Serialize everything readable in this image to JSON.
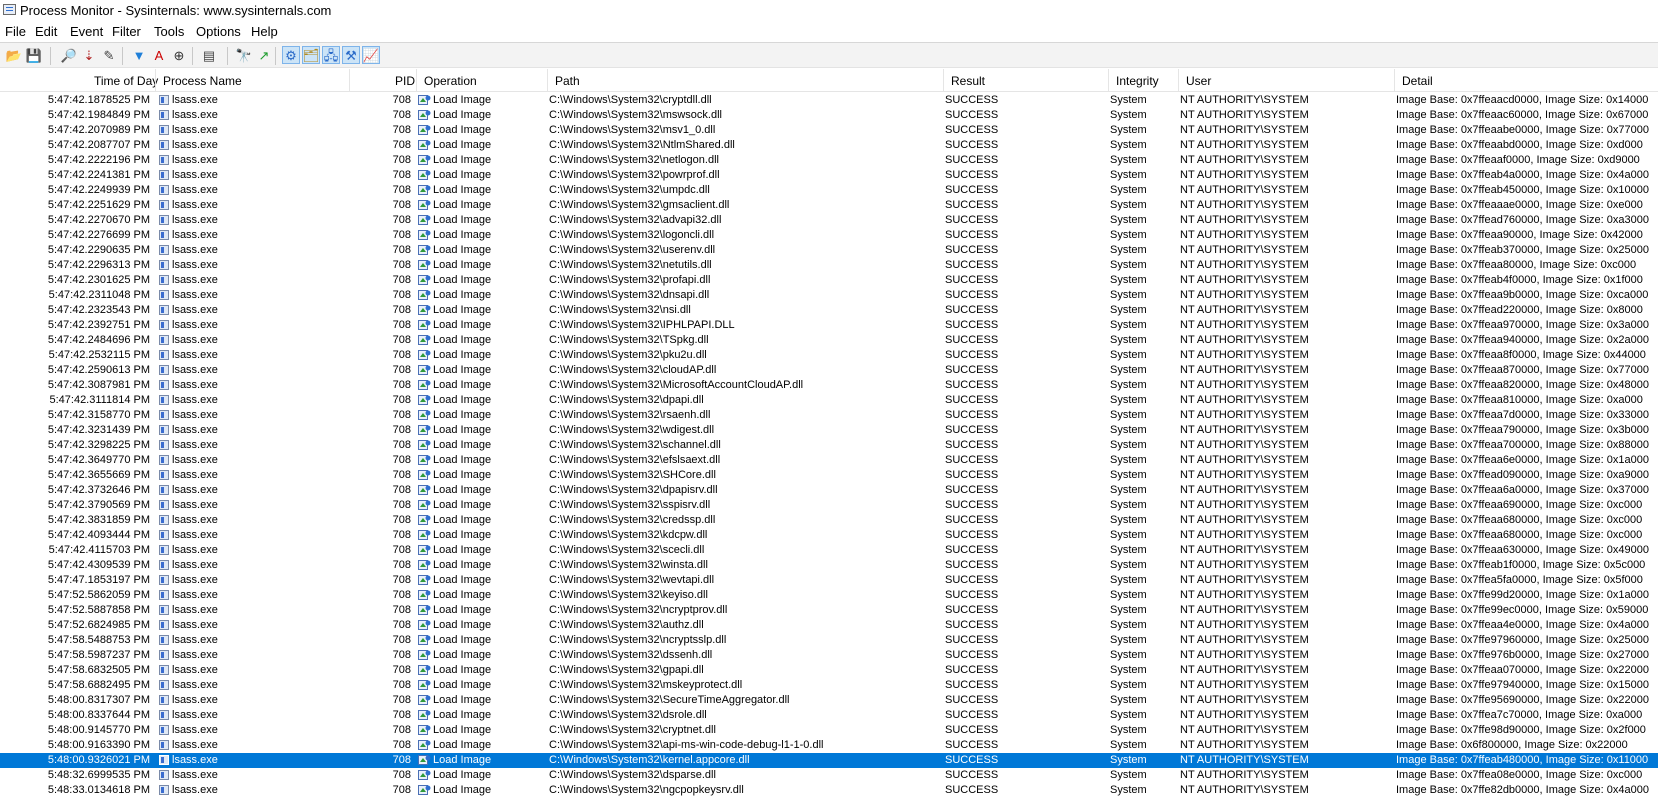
{
  "window": {
    "title": "Process Monitor - Sysinternals: www.sysinternals.com"
  },
  "menu": [
    "File",
    "Edit",
    "Event",
    "Filter",
    "Tools",
    "Options",
    "Help"
  ],
  "toolbar": {
    "buttons": [
      {
        "name": "open-icon",
        "glyph": "📂",
        "color": "#c9a23a",
        "on": false
      },
      {
        "name": "save-icon",
        "glyph": "💾",
        "color": "#333333",
        "on": false
      },
      {
        "name": "capture-icon",
        "glyph": "🔎",
        "color": "#555555",
        "on": false
      },
      {
        "name": "autoscroll-icon",
        "glyph": "⇣",
        "color": "#b02020",
        "on": false
      },
      {
        "name": "clear-icon",
        "glyph": "✎",
        "color": "#444444",
        "on": false
      },
      {
        "name": "filter-icon",
        "glyph": "▼",
        "color": "#1f7fd8",
        "on": false
      },
      {
        "name": "highlight-icon",
        "glyph": "A",
        "color": "#cc0000",
        "on": false
      },
      {
        "name": "include-process-icon",
        "glyph": "⊕",
        "color": "#333333",
        "on": false
      },
      {
        "name": "process-tree-icon",
        "glyph": "▤",
        "color": "#444444",
        "on": false
      },
      {
        "name": "find-icon",
        "glyph": "🔭",
        "color": "#333333",
        "on": false
      },
      {
        "name": "jump-to-icon",
        "glyph": "↗",
        "color": "#1c9c2c",
        "on": false
      },
      {
        "name": "show-registry-icon",
        "glyph": "⚙",
        "color": "#2a6ac8",
        "on": true
      },
      {
        "name": "show-filesystem-icon",
        "glyph": "🗂",
        "color": "#b08a20",
        "on": true
      },
      {
        "name": "show-network-icon",
        "glyph": "🖧",
        "color": "#2a6ac8",
        "on": true
      },
      {
        "name": "show-process-icon",
        "glyph": "⚒",
        "color": "#2a6ac8",
        "on": true
      },
      {
        "name": "show-profiling-icon",
        "glyph": "📈",
        "color": "#1a9c2a",
        "on": true
      }
    ]
  },
  "columns": {
    "time": "Time of Day",
    "process": "Process Name",
    "pid": "PID",
    "operation": "Operation",
    "path": "Path",
    "result": "Result",
    "integrity": "Integrity",
    "user": "User",
    "detail": "Detail"
  },
  "colors": {
    "selection": "#0078d7"
  },
  "selected_row": 44,
  "rows": [
    {
      "time": "5:47:42.1878525 PM",
      "proc": "lsass.exe",
      "pid": "708",
      "op": "Load Image",
      "path": "C:\\Windows\\System32\\cryptdll.dll",
      "result": "SUCCESS",
      "integrity": "System",
      "user": "NT AUTHORITY\\SYSTEM",
      "detail": "Image Base: 0x7ffeaacd0000, Image Size: 0x14000"
    },
    {
      "time": "5:47:42.1984849 PM",
      "proc": "lsass.exe",
      "pid": "708",
      "op": "Load Image",
      "path": "C:\\Windows\\System32\\mswsock.dll",
      "result": "SUCCESS",
      "integrity": "System",
      "user": "NT AUTHORITY\\SYSTEM",
      "detail": "Image Base: 0x7ffeaac60000, Image Size: 0x67000"
    },
    {
      "time": "5:47:42.2070989 PM",
      "proc": "lsass.exe",
      "pid": "708",
      "op": "Load Image",
      "path": "C:\\Windows\\System32\\msv1_0.dll",
      "result": "SUCCESS",
      "integrity": "System",
      "user": "NT AUTHORITY\\SYSTEM",
      "detail": "Image Base: 0x7ffeaabe0000, Image Size: 0x77000"
    },
    {
      "time": "5:47:42.2087707 PM",
      "proc": "lsass.exe",
      "pid": "708",
      "op": "Load Image",
      "path": "C:\\Windows\\System32\\NtlmShared.dll",
      "result": "SUCCESS",
      "integrity": "System",
      "user": "NT AUTHORITY\\SYSTEM",
      "detail": "Image Base: 0x7ffeaabd0000, Image Size: 0xd000"
    },
    {
      "time": "5:47:42.2222196 PM",
      "proc": "lsass.exe",
      "pid": "708",
      "op": "Load Image",
      "path": "C:\\Windows\\System32\\netlogon.dll",
      "result": "SUCCESS",
      "integrity": "System",
      "user": "NT AUTHORITY\\SYSTEM",
      "detail": "Image Base: 0x7ffeaaf0000, Image Size: 0xd9000"
    },
    {
      "time": "5:47:42.2241381 PM",
      "proc": "lsass.exe",
      "pid": "708",
      "op": "Load Image",
      "path": "C:\\Windows\\System32\\powrprof.dll",
      "result": "SUCCESS",
      "integrity": "System",
      "user": "NT AUTHORITY\\SYSTEM",
      "detail": "Image Base: 0x7ffeab4a0000, Image Size: 0x4a000"
    },
    {
      "time": "5:47:42.2249939 PM",
      "proc": "lsass.exe",
      "pid": "708",
      "op": "Load Image",
      "path": "C:\\Windows\\System32\\umpdc.dll",
      "result": "SUCCESS",
      "integrity": "System",
      "user": "NT AUTHORITY\\SYSTEM",
      "detail": "Image Base: 0x7ffeab450000, Image Size: 0x10000"
    },
    {
      "time": "5:47:42.2251629 PM",
      "proc": "lsass.exe",
      "pid": "708",
      "op": "Load Image",
      "path": "C:\\Windows\\System32\\gmsaclient.dll",
      "result": "SUCCESS",
      "integrity": "System",
      "user": "NT AUTHORITY\\SYSTEM",
      "detail": "Image Base: 0x7ffeaaae0000, Image Size: 0xe000"
    },
    {
      "time": "5:47:42.2270670 PM",
      "proc": "lsass.exe",
      "pid": "708",
      "op": "Load Image",
      "path": "C:\\Windows\\System32\\advapi32.dll",
      "result": "SUCCESS",
      "integrity": "System",
      "user": "NT AUTHORITY\\SYSTEM",
      "detail": "Image Base: 0x7ffead760000, Image Size: 0xa3000"
    },
    {
      "time": "5:47:42.2276699 PM",
      "proc": "lsass.exe",
      "pid": "708",
      "op": "Load Image",
      "path": "C:\\Windows\\System32\\logoncli.dll",
      "result": "SUCCESS",
      "integrity": "System",
      "user": "NT AUTHORITY\\SYSTEM",
      "detail": "Image Base: 0x7ffeaa90000, Image Size: 0x42000"
    },
    {
      "time": "5:47:42.2290635 PM",
      "proc": "lsass.exe",
      "pid": "708",
      "op": "Load Image",
      "path": "C:\\Windows\\System32\\userenv.dll",
      "result": "SUCCESS",
      "integrity": "System",
      "user": "NT AUTHORITY\\SYSTEM",
      "detail": "Image Base: 0x7ffeab370000, Image Size: 0x25000"
    },
    {
      "time": "5:47:42.2296313 PM",
      "proc": "lsass.exe",
      "pid": "708",
      "op": "Load Image",
      "path": "C:\\Windows\\System32\\netutils.dll",
      "result": "SUCCESS",
      "integrity": "System",
      "user": "NT AUTHORITY\\SYSTEM",
      "detail": "Image Base: 0x7ffeaa80000, Image Size: 0xc000"
    },
    {
      "time": "5:47:42.2301625 PM",
      "proc": "lsass.exe",
      "pid": "708",
      "op": "Load Image",
      "path": "C:\\Windows\\System32\\profapi.dll",
      "result": "SUCCESS",
      "integrity": "System",
      "user": "NT AUTHORITY\\SYSTEM",
      "detail": "Image Base: 0x7ffeab4f0000, Image Size: 0x1f000"
    },
    {
      "time": "5:47:42.2311048 PM",
      "proc": "lsass.exe",
      "pid": "708",
      "op": "Load Image",
      "path": "C:\\Windows\\System32\\dnsapi.dll",
      "result": "SUCCESS",
      "integrity": "System",
      "user": "NT AUTHORITY\\SYSTEM",
      "detail": "Image Base: 0x7ffeaa9b0000, Image Size: 0xca000"
    },
    {
      "time": "5:47:42.2323543 PM",
      "proc": "lsass.exe",
      "pid": "708",
      "op": "Load Image",
      "path": "C:\\Windows\\System32\\nsi.dll",
      "result": "SUCCESS",
      "integrity": "System",
      "user": "NT AUTHORITY\\SYSTEM",
      "detail": "Image Base: 0x7ffead220000, Image Size: 0x8000"
    },
    {
      "time": "5:47:42.2392751 PM",
      "proc": "lsass.exe",
      "pid": "708",
      "op": "Load Image",
      "path": "C:\\Windows\\System32\\IPHLPAPI.DLL",
      "result": "SUCCESS",
      "integrity": "System",
      "user": "NT AUTHORITY\\SYSTEM",
      "detail": "Image Base: 0x7ffeaa970000, Image Size: 0x3a000"
    },
    {
      "time": "5:47:42.2484696 PM",
      "proc": "lsass.exe",
      "pid": "708",
      "op": "Load Image",
      "path": "C:\\Windows\\System32\\TSpkg.dll",
      "result": "SUCCESS",
      "integrity": "System",
      "user": "NT AUTHORITY\\SYSTEM",
      "detail": "Image Base: 0x7ffeaa940000, Image Size: 0x2a000"
    },
    {
      "time": "5:47:42.2532115 PM",
      "proc": "lsass.exe",
      "pid": "708",
      "op": "Load Image",
      "path": "C:\\Windows\\System32\\pku2u.dll",
      "result": "SUCCESS",
      "integrity": "System",
      "user": "NT AUTHORITY\\SYSTEM",
      "detail": "Image Base: 0x7ffeaa8f0000, Image Size: 0x44000"
    },
    {
      "time": "5:47:42.2590613 PM",
      "proc": "lsass.exe",
      "pid": "708",
      "op": "Load Image",
      "path": "C:\\Windows\\System32\\cloudAP.dll",
      "result": "SUCCESS",
      "integrity": "System",
      "user": "NT AUTHORITY\\SYSTEM",
      "detail": "Image Base: 0x7ffeaa870000, Image Size: 0x77000"
    },
    {
      "time": "5:47:42.3087981 PM",
      "proc": "lsass.exe",
      "pid": "708",
      "op": "Load Image",
      "path": "C:\\Windows\\System32\\MicrosoftAccountCloudAP.dll",
      "result": "SUCCESS",
      "integrity": "System",
      "user": "NT AUTHORITY\\SYSTEM",
      "detail": "Image Base: 0x7ffeaa820000, Image Size: 0x48000"
    },
    {
      "time": "5:47:42.3111814 PM",
      "proc": "lsass.exe",
      "pid": "708",
      "op": "Load Image",
      "path": "C:\\Windows\\System32\\dpapi.dll",
      "result": "SUCCESS",
      "integrity": "System",
      "user": "NT AUTHORITY\\SYSTEM",
      "detail": "Image Base: 0x7ffeaa810000, Image Size: 0xa000"
    },
    {
      "time": "5:47:42.3158770 PM",
      "proc": "lsass.exe",
      "pid": "708",
      "op": "Load Image",
      "path": "C:\\Windows\\System32\\rsaenh.dll",
      "result": "SUCCESS",
      "integrity": "System",
      "user": "NT AUTHORITY\\SYSTEM",
      "detail": "Image Base: 0x7ffeaa7d0000, Image Size: 0x33000"
    },
    {
      "time": "5:47:42.3231439 PM",
      "proc": "lsass.exe",
      "pid": "708",
      "op": "Load Image",
      "path": "C:\\Windows\\System32\\wdigest.dll",
      "result": "SUCCESS",
      "integrity": "System",
      "user": "NT AUTHORITY\\SYSTEM",
      "detail": "Image Base: 0x7ffeaa790000, Image Size: 0x3b000"
    },
    {
      "time": "5:47:42.3298225 PM",
      "proc": "lsass.exe",
      "pid": "708",
      "op": "Load Image",
      "path": "C:\\Windows\\System32\\schannel.dll",
      "result": "SUCCESS",
      "integrity": "System",
      "user": "NT AUTHORITY\\SYSTEM",
      "detail": "Image Base: 0x7ffeaa700000, Image Size: 0x88000"
    },
    {
      "time": "5:47:42.3649770 PM",
      "proc": "lsass.exe",
      "pid": "708",
      "op": "Load Image",
      "path": "C:\\Windows\\System32\\efslsaext.dll",
      "result": "SUCCESS",
      "integrity": "System",
      "user": "NT AUTHORITY\\SYSTEM",
      "detail": "Image Base: 0x7ffeaa6e0000, Image Size: 0x1a000"
    },
    {
      "time": "5:47:42.3655669 PM",
      "proc": "lsass.exe",
      "pid": "708",
      "op": "Load Image",
      "path": "C:\\Windows\\System32\\SHCore.dll",
      "result": "SUCCESS",
      "integrity": "System",
      "user": "NT AUTHORITY\\SYSTEM",
      "detail": "Image Base: 0x7ffead090000, Image Size: 0xa9000"
    },
    {
      "time": "5:47:42.3732646 PM",
      "proc": "lsass.exe",
      "pid": "708",
      "op": "Load Image",
      "path": "C:\\Windows\\System32\\dpapisrv.dll",
      "result": "SUCCESS",
      "integrity": "System",
      "user": "NT AUTHORITY\\SYSTEM",
      "detail": "Image Base: 0x7ffeaa6a0000, Image Size: 0x37000"
    },
    {
      "time": "5:47:42.3790569 PM",
      "proc": "lsass.exe",
      "pid": "708",
      "op": "Load Image",
      "path": "C:\\Windows\\System32\\sspisrv.dll",
      "result": "SUCCESS",
      "integrity": "System",
      "user": "NT AUTHORITY\\SYSTEM",
      "detail": "Image Base: 0x7ffeaa690000, Image Size: 0xc000"
    },
    {
      "time": "5:47:42.3831859 PM",
      "proc": "lsass.exe",
      "pid": "708",
      "op": "Load Image",
      "path": "C:\\Windows\\System32\\credssp.dll",
      "result": "SUCCESS",
      "integrity": "System",
      "user": "NT AUTHORITY\\SYSTEM",
      "detail": "Image Base: 0x7ffeaa680000, Image Size: 0xc000"
    },
    {
      "time": "5:47:42.4093444 PM",
      "proc": "lsass.exe",
      "pid": "708",
      "op": "Load Image",
      "path": "C:\\Windows\\System32\\kdcpw.dll",
      "result": "SUCCESS",
      "integrity": "System",
      "user": "NT AUTHORITY\\SYSTEM",
      "detail": "Image Base: 0x7ffeaa680000, Image Size: 0xc000"
    },
    {
      "time": "5:47:42.4115703 PM",
      "proc": "lsass.exe",
      "pid": "708",
      "op": "Load Image",
      "path": "C:\\Windows\\System32\\scecli.dll",
      "result": "SUCCESS",
      "integrity": "System",
      "user": "NT AUTHORITY\\SYSTEM",
      "detail": "Image Base: 0x7ffeaa630000, Image Size: 0x49000"
    },
    {
      "time": "5:47:42.4309539 PM",
      "proc": "lsass.exe",
      "pid": "708",
      "op": "Load Image",
      "path": "C:\\Windows\\System32\\winsta.dll",
      "result": "SUCCESS",
      "integrity": "System",
      "user": "NT AUTHORITY\\SYSTEM",
      "detail": "Image Base: 0x7ffeab1f0000, Image Size: 0x5c000"
    },
    {
      "time": "5:47:47.1853197 PM",
      "proc": "lsass.exe",
      "pid": "708",
      "op": "Load Image",
      "path": "C:\\Windows\\System32\\wevtapi.dll",
      "result": "SUCCESS",
      "integrity": "System",
      "user": "NT AUTHORITY\\SYSTEM",
      "detail": "Image Base: 0x7ffea5fa0000, Image Size: 0x5f000"
    },
    {
      "time": "5:47:52.5862059 PM",
      "proc": "lsass.exe",
      "pid": "708",
      "op": "Load Image",
      "path": "C:\\Windows\\System32\\keyiso.dll",
      "result": "SUCCESS",
      "integrity": "System",
      "user": "NT AUTHORITY\\SYSTEM",
      "detail": "Image Base: 0x7ffe99d20000, Image Size: 0x1a000"
    },
    {
      "time": "5:47:52.5887858 PM",
      "proc": "lsass.exe",
      "pid": "708",
      "op": "Load Image",
      "path": "C:\\Windows\\System32\\ncryptprov.dll",
      "result": "SUCCESS",
      "integrity": "System",
      "user": "NT AUTHORITY\\SYSTEM",
      "detail": "Image Base: 0x7ffe99ec0000, Image Size: 0x59000"
    },
    {
      "time": "5:47:52.6824985 PM",
      "proc": "lsass.exe",
      "pid": "708",
      "op": "Load Image",
      "path": "C:\\Windows\\System32\\authz.dll",
      "result": "SUCCESS",
      "integrity": "System",
      "user": "NT AUTHORITY\\SYSTEM",
      "detail": "Image Base: 0x7ffeaa4e0000, Image Size: 0x4a000"
    },
    {
      "time": "5:47:58.5488753 PM",
      "proc": "lsass.exe",
      "pid": "708",
      "op": "Load Image",
      "path": "C:\\Windows\\System32\\ncryptsslp.dll",
      "result": "SUCCESS",
      "integrity": "System",
      "user": "NT AUTHORITY\\SYSTEM",
      "detail": "Image Base: 0x7ffe97960000, Image Size: 0x25000"
    },
    {
      "time": "5:47:58.5987237 PM",
      "proc": "lsass.exe",
      "pid": "708",
      "op": "Load Image",
      "path": "C:\\Windows\\System32\\dssenh.dll",
      "result": "SUCCESS",
      "integrity": "System",
      "user": "NT AUTHORITY\\SYSTEM",
      "detail": "Image Base: 0x7ffe976b0000, Image Size: 0x27000"
    },
    {
      "time": "5:47:58.6832505 PM",
      "proc": "lsass.exe",
      "pid": "708",
      "op": "Load Image",
      "path": "C:\\Windows\\System32\\gpapi.dll",
      "result": "SUCCESS",
      "integrity": "System",
      "user": "NT AUTHORITY\\SYSTEM",
      "detail": "Image Base: 0x7ffeaa070000, Image Size: 0x22000"
    },
    {
      "time": "5:47:58.6882495 PM",
      "proc": "lsass.exe",
      "pid": "708",
      "op": "Load Image",
      "path": "C:\\Windows\\System32\\mskeyprotect.dll",
      "result": "SUCCESS",
      "integrity": "System",
      "user": "NT AUTHORITY\\SYSTEM",
      "detail": "Image Base: 0x7ffe97940000, Image Size: 0x15000"
    },
    {
      "time": "5:48:00.8317307 PM",
      "proc": "lsass.exe",
      "pid": "708",
      "op": "Load Image",
      "path": "C:\\Windows\\System32\\SecureTimeAggregator.dll",
      "result": "SUCCESS",
      "integrity": "System",
      "user": "NT AUTHORITY\\SYSTEM",
      "detail": "Image Base: 0x7ffe95690000, Image Size: 0x22000"
    },
    {
      "time": "5:48:00.8337644 PM",
      "proc": "lsass.exe",
      "pid": "708",
      "op": "Load Image",
      "path": "C:\\Windows\\System32\\dsrole.dll",
      "result": "SUCCESS",
      "integrity": "System",
      "user": "NT AUTHORITY\\SYSTEM",
      "detail": "Image Base: 0x7ffea7c70000, Image Size: 0xa000"
    },
    {
      "time": "5:48:00.9145770 PM",
      "proc": "lsass.exe",
      "pid": "708",
      "op": "Load Image",
      "path": "C:\\Windows\\System32\\cryptnet.dll",
      "result": "SUCCESS",
      "integrity": "System",
      "user": "NT AUTHORITY\\SYSTEM",
      "detail": "Image Base: 0x7ffe98d90000, Image Size: 0x2f000"
    },
    {
      "time": "5:48:00.9163390 PM",
      "proc": "lsass.exe",
      "pid": "708",
      "op": "Load Image",
      "path": "C:\\Windows\\System32\\api-ms-win-code-debug-l1-1-0.dll",
      "result": "SUCCESS",
      "integrity": "System",
      "user": "NT AUTHORITY\\SYSTEM",
      "detail": "Image Base: 0x6f800000, Image Size: 0x22000"
    },
    {
      "time": "5:48:00.9326021 PM",
      "proc": "lsass.exe",
      "pid": "708",
      "op": "Load Image",
      "path": "C:\\Windows\\System32\\kernel.appcore.dll",
      "result": "SUCCESS",
      "integrity": "System",
      "user": "NT AUTHORITY\\SYSTEM",
      "detail": "Image Base: 0x7ffeab480000, Image Size: 0x11000"
    },
    {
      "time": "5:48:32.6999535 PM",
      "proc": "lsass.exe",
      "pid": "708",
      "op": "Load Image",
      "path": "C:\\Windows\\System32\\dsparse.dll",
      "result": "SUCCESS",
      "integrity": "System",
      "user": "NT AUTHORITY\\SYSTEM",
      "detail": "Image Base: 0x7ffea08e0000, Image Size: 0xc000"
    },
    {
      "time": "5:48:33.0134618 PM",
      "proc": "lsass.exe",
      "pid": "708",
      "op": "Load Image",
      "path": "C:\\Windows\\System32\\ngcpopkeysrv.dll",
      "result": "SUCCESS",
      "integrity": "System",
      "user": "NT AUTHORITY\\SYSTEM",
      "detail": "Image Base: 0x7ffe82db0000, Image Size: 0x4a000"
    }
  ]
}
